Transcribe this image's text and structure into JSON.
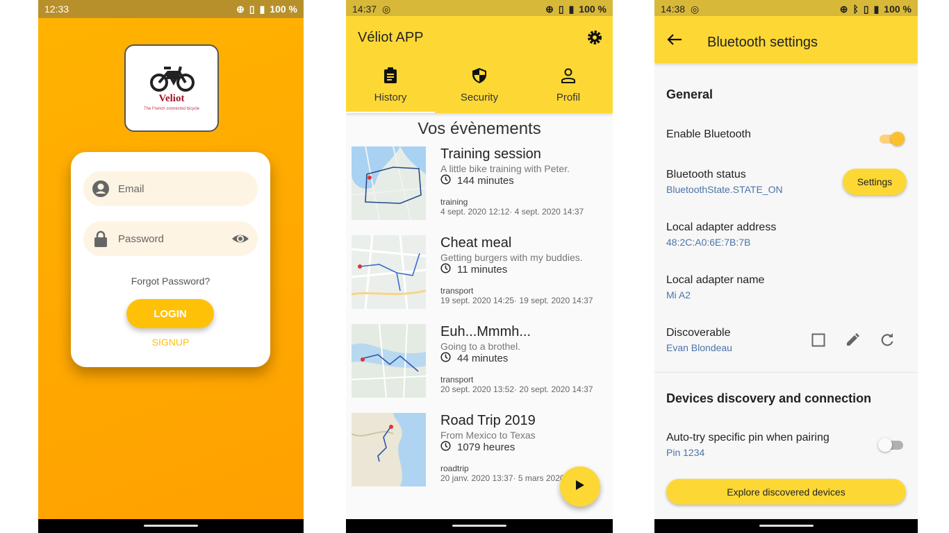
{
  "login_screen": {
    "status": {
      "time": "12:33",
      "battery": "100 %"
    },
    "logo": {
      "name": "Veliot",
      "tagline": "The French connected bicycle"
    },
    "email_placeholder": "Email",
    "password_placeholder": "Password",
    "forgot_label": "Forgot Password?",
    "login_label": "LOGIN",
    "signup_label": "SIGNUP"
  },
  "history_screen": {
    "status": {
      "time": "14:37",
      "battery": "100 %"
    },
    "app_title": "Véliot APP",
    "tabs": [
      {
        "label": "History",
        "icon": "clipboard-icon"
      },
      {
        "label": "Security",
        "icon": "shield-icon"
      },
      {
        "label": "Profil",
        "icon": "person-icon"
      }
    ],
    "section_title": "Vos évènements",
    "events": [
      {
        "title": "Training session",
        "description": "A little bike training with Peter.",
        "duration": "144 minutes",
        "tag": "training",
        "dates": "4 sept. 2020 12:12· 4 sept. 2020 14:37"
      },
      {
        "title": "Cheat meal",
        "description": "Getting burgers with my buddies.",
        "duration": "11 minutes",
        "tag": "transport",
        "dates": "19 sept. 2020 14:25· 19 sept. 2020 14:37"
      },
      {
        "title": "Euh...Mmmh...",
        "description": "Going to a brothel.",
        "duration": "44 minutes",
        "tag": "transport",
        "dates": "20 sept. 2020 13:52· 20 sept. 2020 14:37"
      },
      {
        "title": "Road Trip 2019",
        "description": "From Mexico to Texas",
        "duration": "1079 heures",
        "tag": "roadtrip",
        "dates": "20 janv. 2020 13:37· 5 mars 2020"
      }
    ]
  },
  "bluetooth_screen": {
    "status": {
      "time": "14:38",
      "battery": "100 %"
    },
    "title": "Bluetooth settings",
    "general_header": "General",
    "enable_label": "Enable Bluetooth",
    "enable_on": true,
    "status_label": "Bluetooth status",
    "status_value": "BluetoothState.STATE_ON",
    "settings_button": "Settings",
    "address_label": "Local adapter address",
    "address_value": "48:2C:A0:6E:7B:7B",
    "name_label": "Local adapter name",
    "name_value": "Mi A2",
    "discoverable_label": "Discoverable",
    "discoverable_value": "Evan Blondeau",
    "devices_header": "Devices discovery and connection",
    "autopin_label": "Auto-try specific pin when pairing",
    "autopin_value": "Pin 1234",
    "autopin_on": false,
    "explore_button": "Explore discovered devices"
  },
  "colors": {
    "accent": "#fdd835",
    "login_bg": "#ffa000",
    "link_blue": "#4a73a8"
  }
}
